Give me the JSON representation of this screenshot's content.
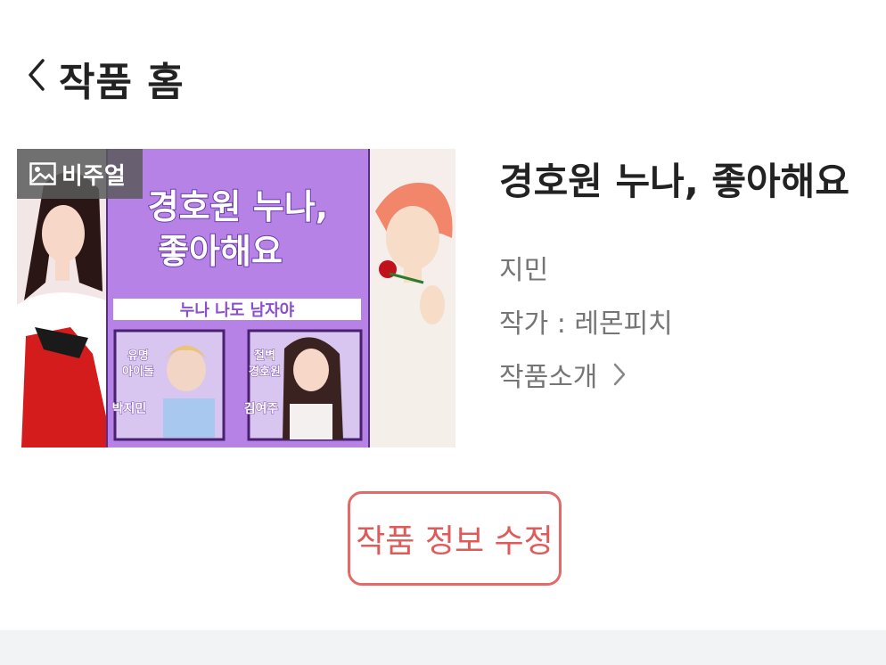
{
  "header": {
    "title": "작품 홈"
  },
  "cover": {
    "badge_label": "비주얼",
    "art_title_line1": "경호원 누나,",
    "art_title_line2": "좋아해요",
    "art_tagline": "누나 나도 남자야",
    "left_card_caption1": "유명",
    "left_card_caption2": "아이돌",
    "left_card_name": "박지민",
    "right_card_caption1": "철벽",
    "right_card_caption2": "경호원",
    "right_card_name": "김여주"
  },
  "info": {
    "title": "경호원 누나, 좋아해요",
    "genre": "지민",
    "author": "작가 : 레몬피치",
    "intro_label": "작품소개"
  },
  "actions": {
    "edit_label": "작품 정보 수정"
  },
  "colors": {
    "accent": "#e05a5a",
    "cover_purple": "#b682e6"
  }
}
